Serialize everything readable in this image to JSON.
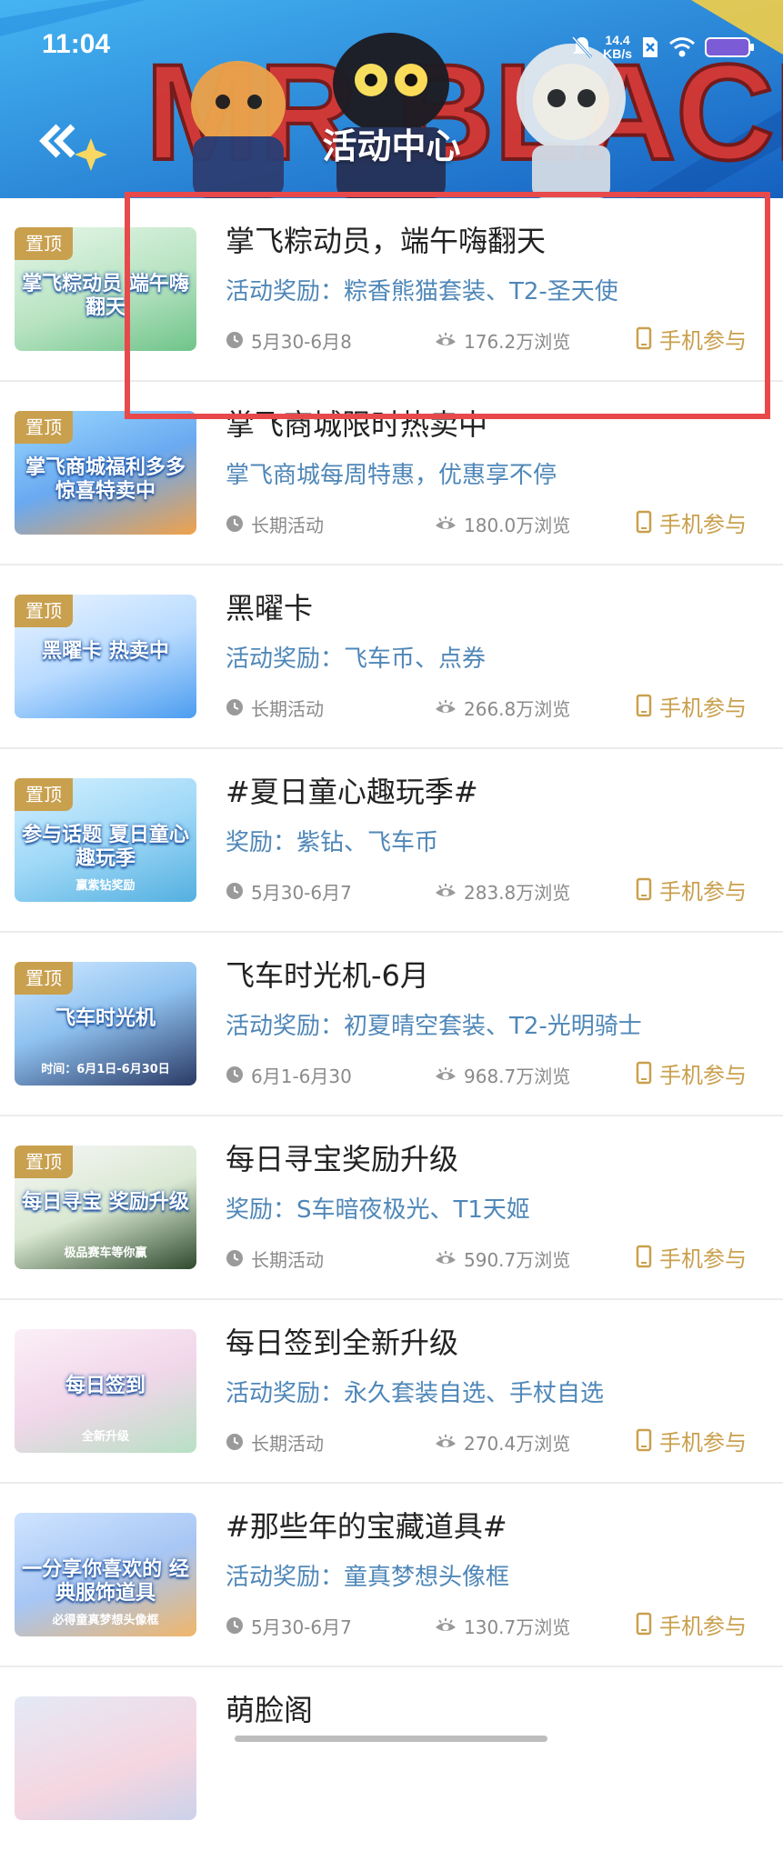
{
  "status_bar": {
    "time": "11:04",
    "net_speed_value": "14.4",
    "net_speed_unit": "KB/s"
  },
  "header": {
    "banner_art_text": "MR.BLACK",
    "title": "活动中心",
    "back_icon": "double-chevron-left-icon"
  },
  "colors": {
    "header_blue": "#1f7fd8",
    "pin_gold": "#c9a04e",
    "reward_blue": "#4f87b8",
    "highlight_red": "#e8494a"
  },
  "items": [
    {
      "pinned_label": "置顶",
      "thumb_text": "掌飞粽动员 端午嗨翻天",
      "thumb_sub": "",
      "title": "掌飞粽动员，端午嗨翻天",
      "reward": "活动奖励：粽香熊猫套装、T2-圣天使",
      "date": "5月30-6月8",
      "views": "176.2万浏览",
      "join": "手机参与"
    },
    {
      "pinned_label": "置顶",
      "thumb_text": "掌飞商城福利多多 惊喜特卖中",
      "thumb_sub": "",
      "title": "掌飞商城限时热卖中",
      "reward": "掌飞商城每周特惠，优惠享不停",
      "date": "长期活动",
      "views": "180.0万浏览",
      "join": "手机参与"
    },
    {
      "pinned_label": "置顶",
      "thumb_text": "黑曜卡 热卖中",
      "thumb_sub": "",
      "title": "黑曜卡",
      "reward": "活动奖励：飞车币、点券",
      "date": "长期活动",
      "views": "266.8万浏览",
      "join": "手机参与"
    },
    {
      "pinned_label": "置顶",
      "thumb_text": "参与话题 夏日童心趣玩季",
      "thumb_sub": "赢紫钻奖励",
      "title": "#夏日童心趣玩季#",
      "reward": "奖励：紫钻、飞车币",
      "date": "5月30-6月7",
      "views": "283.8万浏览",
      "join": "手机参与"
    },
    {
      "pinned_label": "置顶",
      "thumb_text": "飞车时光机",
      "thumb_sub": "时间：6月1日-6月30日",
      "title": "飞车时光机-6月",
      "reward": "活动奖励：初夏晴空套装、T2-光明骑士",
      "date": "6月1-6月30",
      "views": "968.7万浏览",
      "join": "手机参与"
    },
    {
      "pinned_label": "置顶",
      "thumb_text": "每日寻宝 奖励升级",
      "thumb_sub": "极品赛车等你赢",
      "title": "每日寻宝奖励升级",
      "reward": "奖励：S车暗夜极光、T1天姬",
      "date": "长期活动",
      "views": "590.7万浏览",
      "join": "手机参与"
    },
    {
      "pinned_label": "",
      "thumb_text": "每日签到",
      "thumb_sub": "全新升级",
      "title": "每日签到全新升级",
      "reward": "活动奖励：永久套装自选、手杖自选",
      "date": "长期活动",
      "views": "270.4万浏览",
      "join": "手机参与"
    },
    {
      "pinned_label": "",
      "thumb_text": "一分享你喜欢的 经典服饰道具",
      "thumb_sub": "必得童真梦想头像框",
      "title": "#那些年的宝藏道具#",
      "reward": "活动奖励：童真梦想头像框",
      "date": "5月30-6月7",
      "views": "130.7万浏览",
      "join": "手机参与"
    },
    {
      "pinned_label": "",
      "thumb_text": "",
      "thumb_sub": "",
      "title": "萌脸阁",
      "reward": "",
      "date": "",
      "views": "",
      "join": ""
    }
  ]
}
